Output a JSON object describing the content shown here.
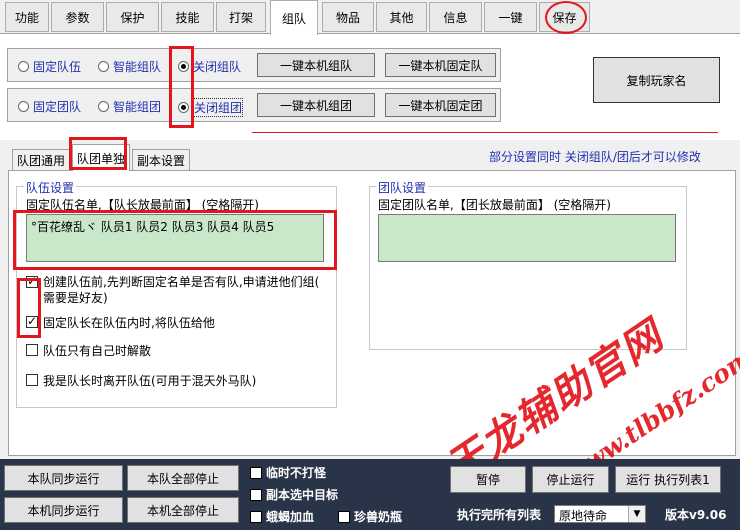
{
  "top_tabs": [
    "功能",
    "参数",
    "保护",
    "技能",
    "打架",
    "组队",
    "物品",
    "其他",
    "信息",
    "一键",
    "保存"
  ],
  "group_rows": {
    "team": {
      "opt_fixed": "固定队伍",
      "opt_smart": "智能组队",
      "opt_close": "关闭组队",
      "btn_one_click": "一键本机组队",
      "btn_one_click_fixed": "一键本机固定队"
    },
    "corps": {
      "opt_fixed": "固定团队",
      "opt_smart": "智能组团",
      "opt_close": "关闭组团",
      "btn_one_click": "一键本机组团",
      "btn_one_click_fixed": "一键本机固定团"
    },
    "copy_player_name": "复制玩家名"
  },
  "sub_tabs": [
    "队团通用",
    "队团单独",
    "副本设置"
  ],
  "notice": "部分设置同时 关闭组队/团后才可以修改",
  "team_settings": {
    "legend": "队伍设置",
    "label": "固定队伍名单,【队长放最前面】 (空格隔开)",
    "value": "°百花缭乱ヾ  队员1 队员2 队员3 队员4 队员5",
    "checks": [
      {
        "line1": "创建队伍前,先判断固定名单是否有队,申请进他们组(",
        "line2": "需要是好友)",
        "checked": true
      },
      {
        "line1": "固定队长在队伍内时,将队伍给他",
        "line2": "",
        "checked": true
      },
      {
        "line1": "队伍只有自己时解散",
        "line2": "",
        "checked": false
      },
      {
        "line1": "我是队长时离开队伍(可用于混天外马队)",
        "line2": "",
        "checked": false
      }
    ]
  },
  "corps_settings": {
    "legend": "团队设置",
    "label": "固定团队名单,【团长放最前面】 (空格隔开)",
    "value": ""
  },
  "watermark": {
    "line1": "天龙辅助官网",
    "line2": "www.tlbbfz.com"
  },
  "bottom": {
    "btn_team_sync": "本队同步运行",
    "btn_team_stop_all": "本队全部停止",
    "btn_local_sync": "本机同步运行",
    "btn_local_stop_all": "本机全部停止",
    "chk_no_fight": "临时不打怪",
    "chk_dungeon_target": "副本选中目标",
    "chk_firefly": "蛾蝎加血",
    "chk_pet_milk": "珍兽奶瓶",
    "btn_pause": "暂停",
    "btn_stop": "停止运行",
    "btn_run_list": "运行 执行列表1",
    "after_list_label": "执行完所有列表",
    "after_list_value": "原地待命",
    "version": "版本v9.06"
  }
}
